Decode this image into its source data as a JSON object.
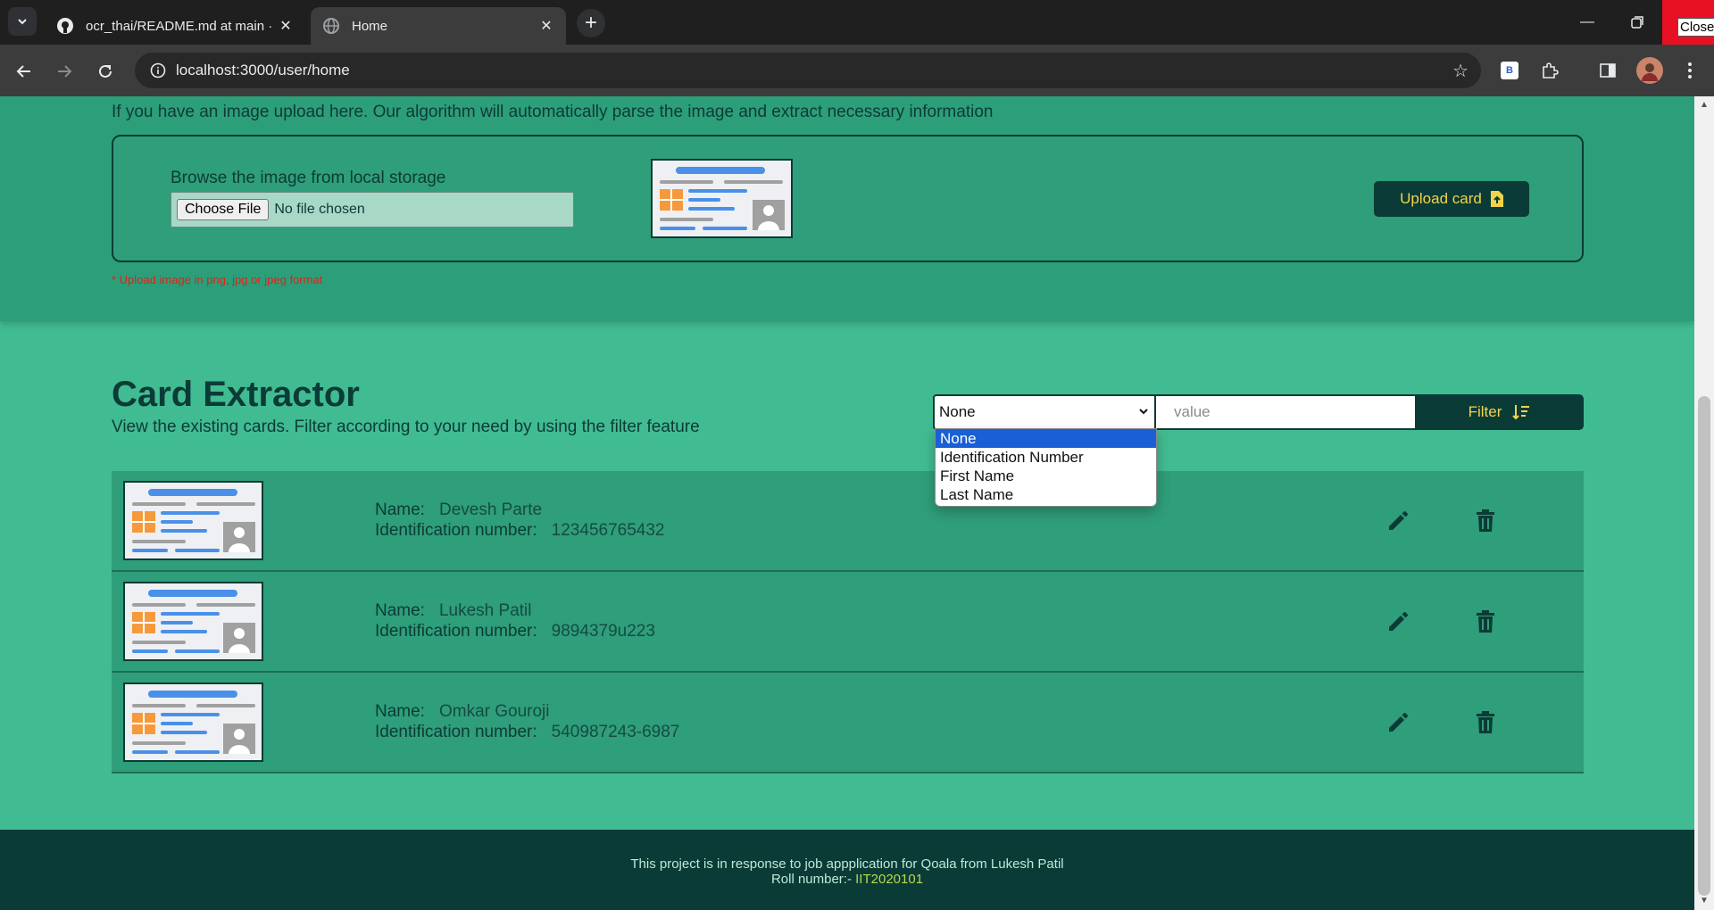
{
  "browser": {
    "tabs": [
      {
        "title": "ocr_thai/README.md at main · l"
      },
      {
        "title": "Home"
      }
    ],
    "url": "localhost:3000/user/home",
    "close_label": "Close",
    "extension_label": "B"
  },
  "upload": {
    "description": "If you have an image upload here. Our algorithm will automatically parse the image and extract necessary information",
    "browse_label": "Browse the image from local storage",
    "choose_file_label": "Choose File",
    "no_file_text": "No file chosen",
    "button_label": "Upload card",
    "format_note": "* Upload image in png, jpg or jpeg format"
  },
  "extractor": {
    "title": "Card Extractor",
    "description": "View the existing cards. Filter according to your need by using the filter feature",
    "filter": {
      "selected": "None",
      "options": [
        "None",
        "Identification Number",
        "First Name",
        "Last Name"
      ],
      "value_placeholder": "value",
      "button_label": "Filter"
    },
    "name_label": "Name:",
    "id_label": "Identification number:",
    "cards": [
      {
        "name": "Devesh Parte",
        "id_number": "123456765432"
      },
      {
        "name": "Lukesh Patil",
        "id_number": "9894379u223"
      },
      {
        "name": "Omkar Gouroji",
        "id_number": "540987243-6987"
      }
    ]
  },
  "footer": {
    "line1": "This project is in response to job appplication for Qoala from Lukesh Patil",
    "roll_label": "Roll number:-",
    "roll_value": "IIT2020101"
  },
  "colors": {
    "page_bg": "#41bb92",
    "section_bg": "#2f9e7a",
    "dark": "#0b3b36",
    "accent_text": "#f3d34a",
    "error": "#d8261b"
  }
}
